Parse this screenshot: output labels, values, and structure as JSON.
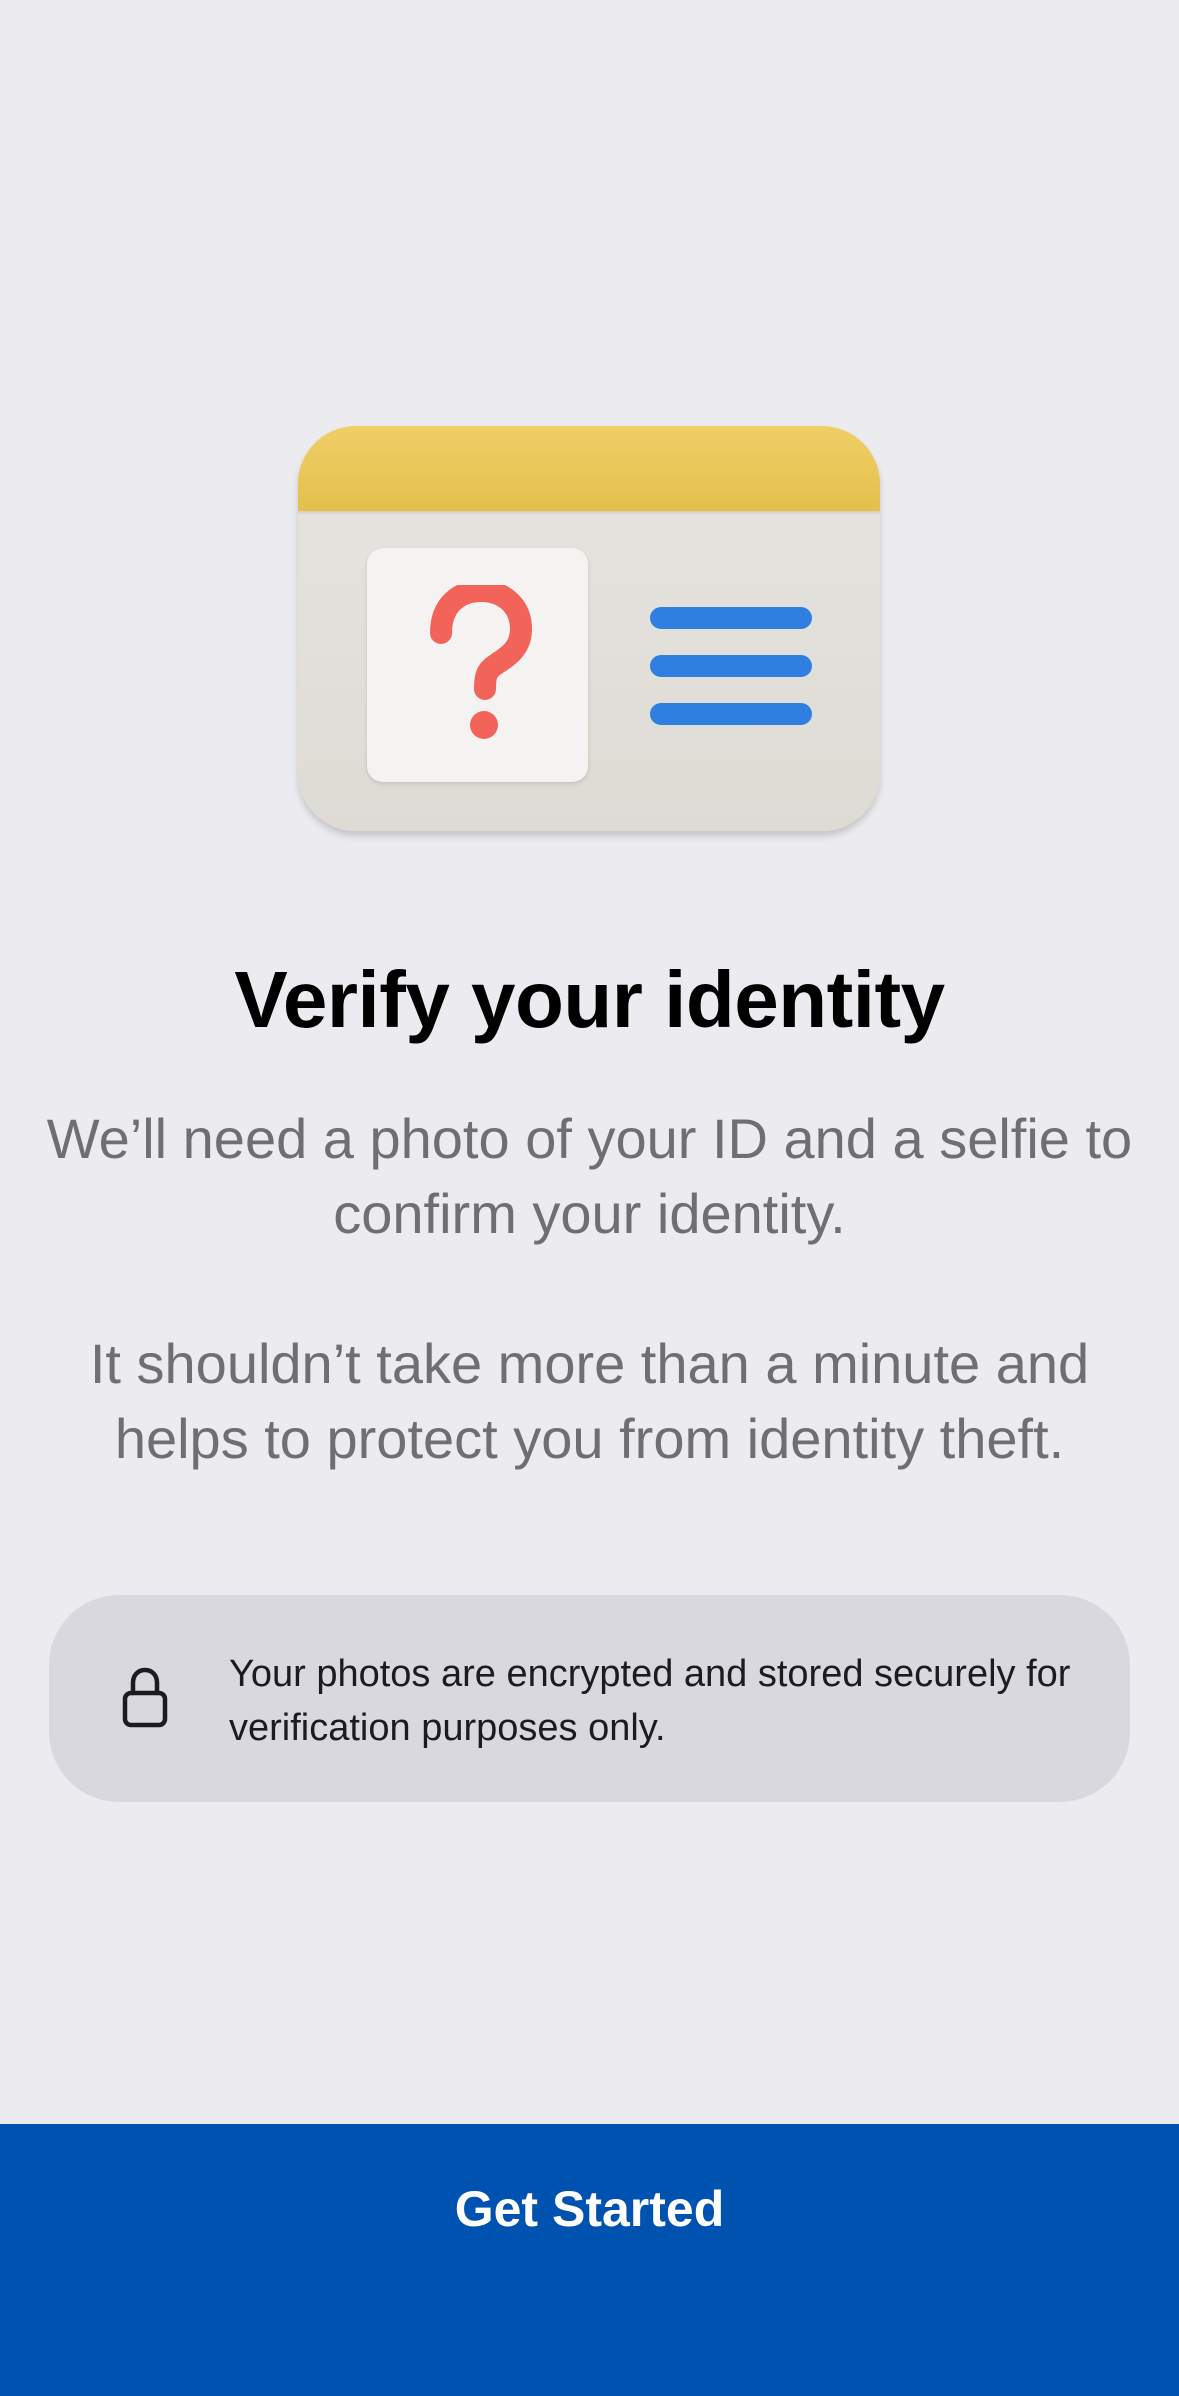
{
  "illustration": {
    "icon": "id-card-question-icon",
    "colors": {
      "card": "#e3e1dc",
      "band": "#e9c85a",
      "question_mark": "#f2645a",
      "lines": "#2f7fe0"
    }
  },
  "header": {
    "title": "Verify your identity"
  },
  "body": {
    "paragraph_1": "We’ll need a photo of your ID and a selfie to confirm your identity.",
    "paragraph_2": "It shouldn’t take more than a minute and helps to protect you from identity theft."
  },
  "notice": {
    "icon": "lock-icon",
    "text": "Your photos are encrypted and stored securely for verification purposes only."
  },
  "footer": {
    "button_label": "Get Started",
    "button_color": "#0052b0"
  }
}
